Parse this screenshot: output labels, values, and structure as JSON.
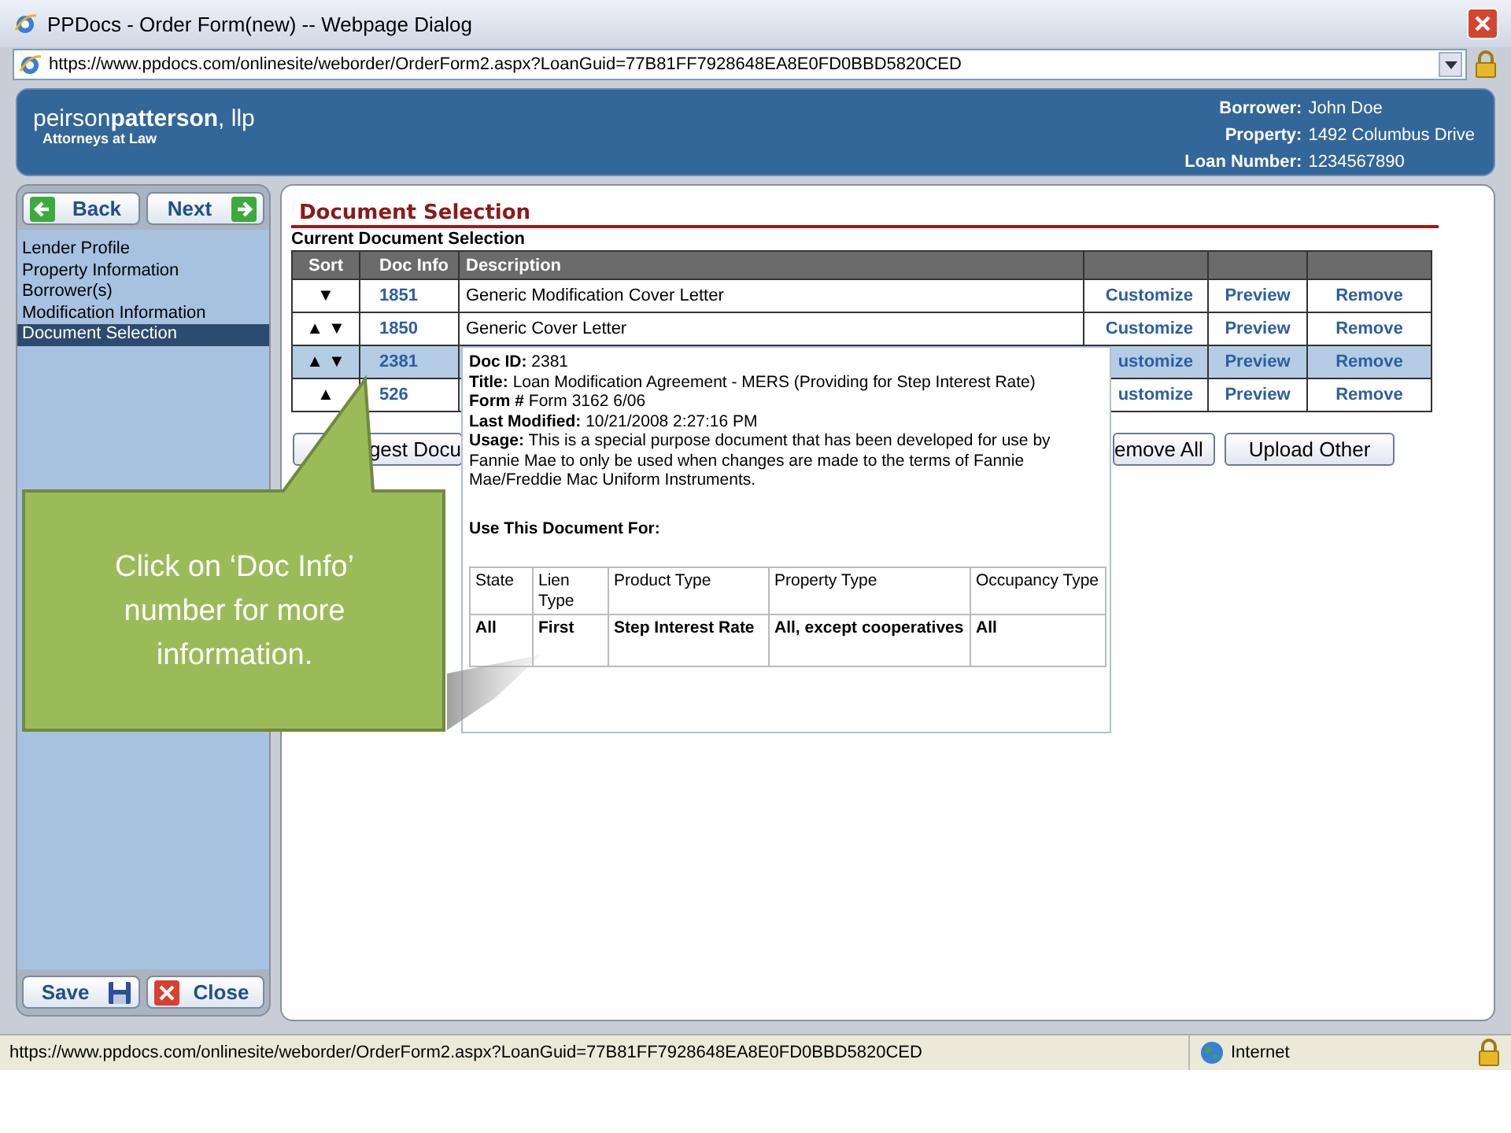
{
  "window": {
    "title": "PPDocs - Order Form(new) -- Webpage Dialog",
    "address": "https://www.ppdocs.com/onlinesite/weborder/OrderForm2.aspx?LoanGuid=77B81FF7928648EA8E0FD0BBD5820CED"
  },
  "header": {
    "logo_light": "peirson",
    "logo_bold": "patterson",
    "logo_suffix": ", llp",
    "tagline": "Attorneys at Law",
    "fields": [
      {
        "label": "Borrower:",
        "value": "John Doe"
      },
      {
        "label": "Property:",
        "value": "1492 Columbus Drive"
      },
      {
        "label": "Loan Number:",
        "value": "1234567890"
      }
    ]
  },
  "sidebar": {
    "nav_buttons": [
      {
        "label": "Back",
        "kind": "back"
      },
      {
        "label": "Next",
        "kind": "next"
      }
    ],
    "items": [
      {
        "label": "Lender Profile",
        "selected": false
      },
      {
        "label": "Property Information",
        "selected": false
      },
      {
        "label": "Borrower(s)",
        "selected": false
      },
      {
        "label": "Modification Information",
        "selected": false
      },
      {
        "label": "Document Selection",
        "selected": true
      }
    ],
    "footer_buttons": [
      {
        "label": "Save",
        "kind": "save"
      },
      {
        "label": "Close",
        "kind": "close"
      }
    ]
  },
  "document_selection": {
    "title": "Document Selection",
    "subtitle": "Current Document Selection",
    "columns": [
      "Sort",
      "Doc Info",
      "Description"
    ],
    "rows": [
      {
        "sort": "▼",
        "doc_id": "1851",
        "description": "Generic Modification Cover Letter",
        "actions": [
          "Customize",
          "Preview",
          "Remove"
        ],
        "selected": false
      },
      {
        "sort": "▲ ▼",
        "doc_id": "1850",
        "description": "Generic Cover Letter",
        "actions": [
          "Customize",
          "Preview",
          "Remove"
        ],
        "selected": false
      },
      {
        "sort": "▲ ▼",
        "doc_id": "2381",
        "actions": [
          "ustomize",
          "Preview",
          "Remove"
        ],
        "selected": true
      },
      {
        "sort": "▲",
        "doc_id": "526",
        "actions": [
          "ustomize",
          "Preview",
          "Remove"
        ],
        "selected": false
      }
    ],
    "buttons": [
      {
        "label": "gest Docu",
        "kind": "left"
      },
      {
        "label": "emove All",
        "kind": "right"
      },
      {
        "label": "Upload Other",
        "kind": "full"
      }
    ]
  },
  "tooltip": {
    "lines": [
      "**Doc ID:** 2381",
      "**Title:** Loan Modification Agreement - MERS (Providing for Step Interest Rate)",
      "**Form #** Form 3162 6/06",
      "**Last Modified:** 10/21/2008 2:27:16 PM",
      "**Usage:** This is a special purpose document that has been developed for use by Fannie Mae to only be used when changes are made to the terms of Fannie Mae/Freddie Mac Uniform Instruments."
    ],
    "usage_heading": "Use This Document For:",
    "table": {
      "columns": [
        "State",
        "Lien Type",
        "Product Type",
        "Property Type",
        "Occupancy Type"
      ],
      "row": [
        "All",
        "First",
        "Step Interest Rate",
        "All, except cooperatives",
        "All"
      ]
    }
  },
  "callout": {
    "text": "Click on ‘Doc Info’ number for more information."
  },
  "status_bar": {
    "url": "https://www.ppdocs.com/onlinesite/weborder/OrderForm2.aspx?LoanGuid=77B81FF7928648EA8E0FD0BBD5820CED",
    "zone": "Internet"
  }
}
